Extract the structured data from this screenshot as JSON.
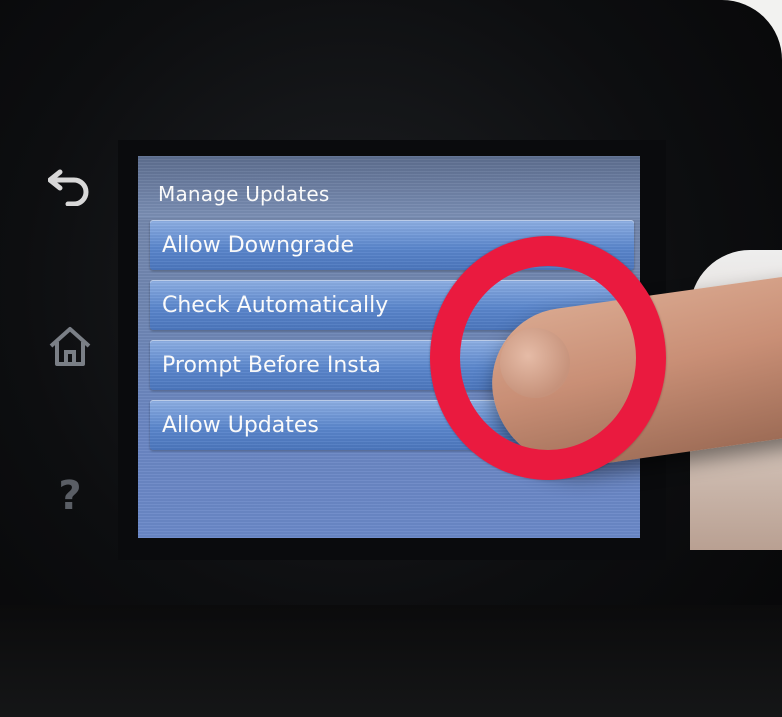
{
  "screen": {
    "title": "Manage Updates",
    "items": [
      {
        "label": "Allow Downgrade"
      },
      {
        "label": "Check Automatically"
      },
      {
        "label": "Prompt Before Insta"
      },
      {
        "label": "Allow Updates"
      }
    ]
  },
  "side_buttons": [
    {
      "icon": "back-arrow-icon"
    },
    {
      "icon": "home-icon"
    },
    {
      "icon": "help-icon",
      "glyph": "?"
    }
  ],
  "annotation": {
    "shape": "circle",
    "color": "#ea1a3f"
  }
}
